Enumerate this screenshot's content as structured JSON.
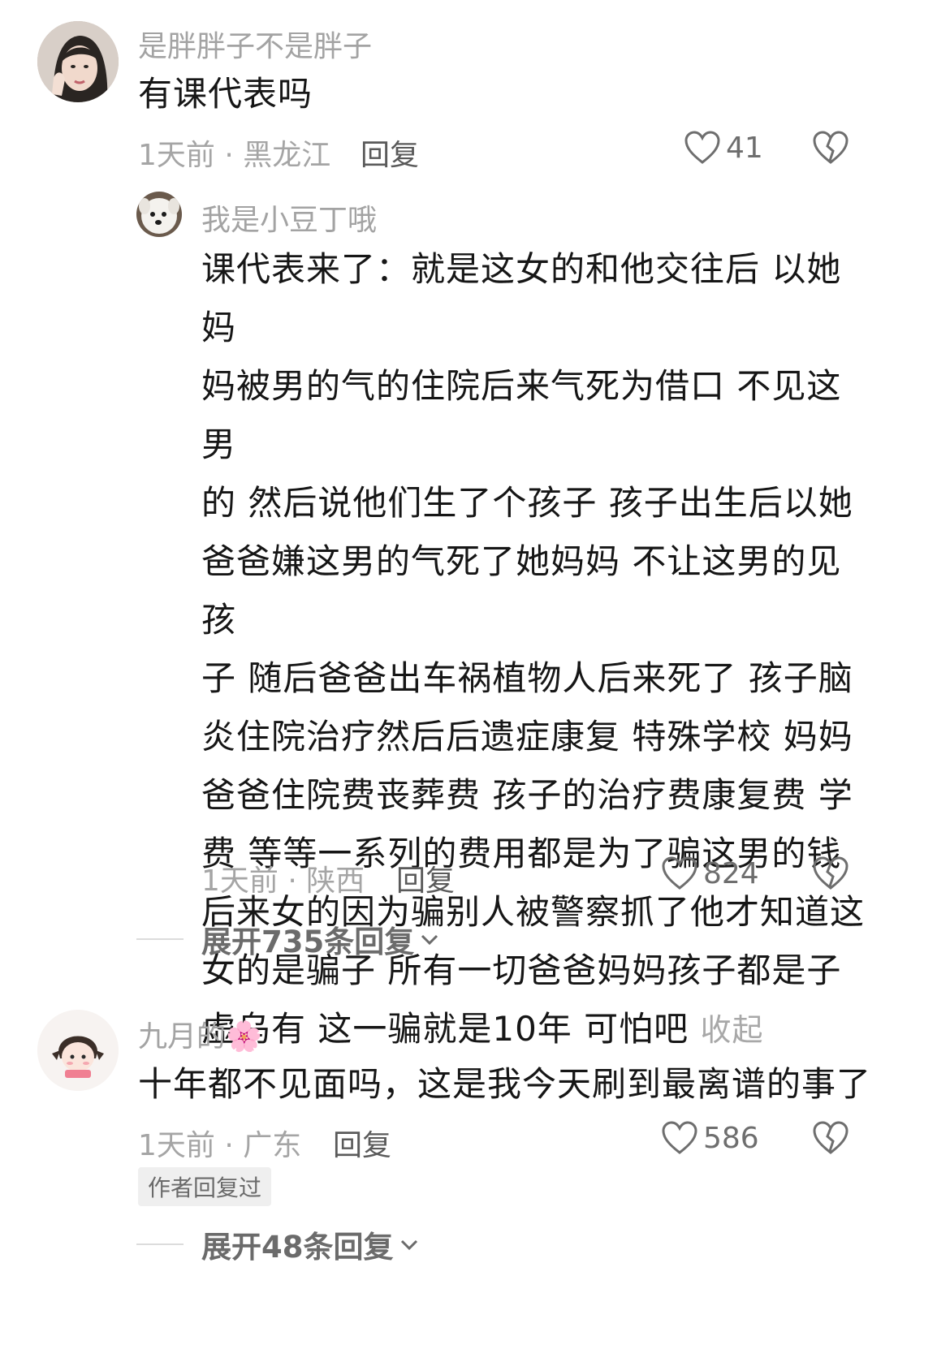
{
  "comments": [
    {
      "username": "是胖胖子不是胖子",
      "text": "有课代表吗",
      "time": "1天前",
      "sep": "·",
      "location": "黑龙江",
      "reply_label": "回复",
      "likes": "41",
      "replies": [
        {
          "username": "我是小豆丁哦",
          "lines": [
            "课代表来了：就是这女的和他交往后 以她妈",
            "妈被男的气的住院后来气死为借口 不见这男",
            "的 然后说他们生了个孩子  孩子出生后以她",
            "爸爸嫌这男的气死了她妈妈 不让这男的见孩",
            "子  随后爸爸出车祸植物人后来死了  孩子脑",
            "炎住院治疗然后后遗症康复 特殊学校  妈妈",
            "爸爸住院费丧葬费 孩子的治疗费康复费 学",
            "费 等等一系列的费用都是为了骗这男的钱",
            "后来女的因为骗别人被警察抓了他才知道这",
            "女的是骗子  所有一切爸爸妈妈孩子都是子",
            "虚乌有  这一骗就是10年 可怕吧"
          ],
          "collapse_label": "收起",
          "time": "1天前",
          "sep": "·",
          "location": "陕西",
          "reply_label": "回复",
          "likes": "824"
        }
      ],
      "expand_label": "展开735条回复"
    },
    {
      "username": "九月的🌸",
      "text": "十年都不见面吗，这是我今天刷到最离谱的事了",
      "time": "1天前",
      "sep": "·",
      "location": "广东",
      "reply_label": "回复",
      "likes": "586",
      "author_badge": "作者回复过",
      "expand_label": "展开48条回复"
    }
  ],
  "colors": {
    "meta": "#a5a5a5",
    "username": "#a3a3a3",
    "content": "#161616",
    "heart_stroke": "#6e6e6e"
  },
  "icons": [
    "heart-icon",
    "broken-heart-icon",
    "chevron-down-icon",
    "avatar-icon"
  ]
}
